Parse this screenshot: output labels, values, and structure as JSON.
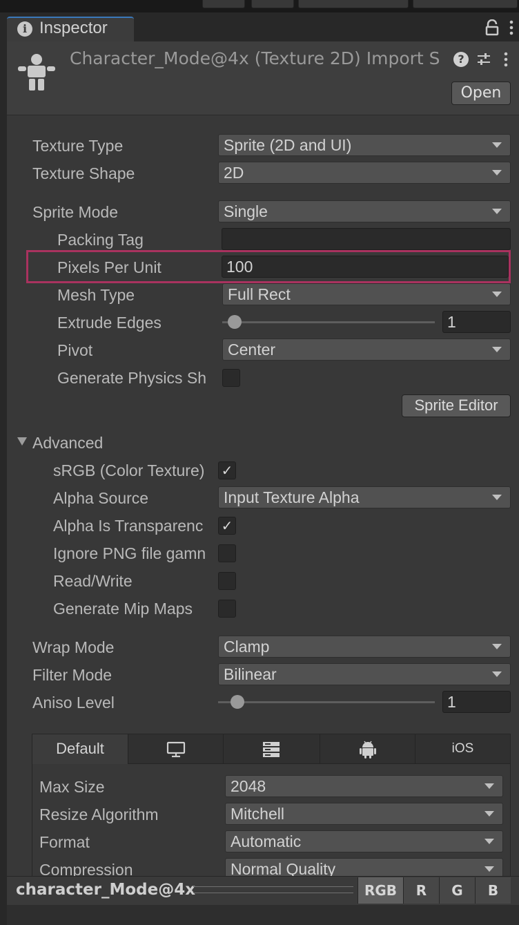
{
  "tab": {
    "title": "Inspector",
    "icon": "info-icon"
  },
  "header": {
    "title": "Character_Mode@4x (Texture 2D) Import S",
    "open_label": "Open",
    "icon": "character-icon"
  },
  "fields": {
    "texture_type": {
      "label": "Texture Type",
      "value": "Sprite (2D and UI)"
    },
    "texture_shape": {
      "label": "Texture Shape",
      "value": "2D"
    },
    "sprite_mode": {
      "label": "Sprite Mode",
      "value": "Single"
    },
    "packing_tag": {
      "label": "Packing Tag",
      "value": ""
    },
    "pixels_per_unit": {
      "label": "Pixels Per Unit",
      "value": "100"
    },
    "mesh_type": {
      "label": "Mesh Type",
      "value": "Full Rect"
    },
    "extrude_edges": {
      "label": "Extrude Edges",
      "value": "1",
      "slider_fraction": 0.06
    },
    "pivot": {
      "label": "Pivot",
      "value": "Center"
    },
    "generate_physics": {
      "label": "Generate Physics Sh",
      "checked": false
    },
    "sprite_editor_label": "Sprite Editor"
  },
  "advanced": {
    "label": "Advanced",
    "srgb": {
      "label": "sRGB (Color Texture)",
      "checked": true
    },
    "alpha_source": {
      "label": "Alpha Source",
      "value": "Input Texture Alpha"
    },
    "alpha_is_transparency": {
      "label": "Alpha Is Transparenc",
      "checked": true
    },
    "ignore_png_gamma": {
      "label": "Ignore PNG file gamn",
      "checked": false
    },
    "read_write": {
      "label": "Read/Write",
      "checked": false
    },
    "generate_mip_maps": {
      "label": "Generate Mip Maps",
      "checked": false
    }
  },
  "wrap": {
    "wrap_mode": {
      "label": "Wrap Mode",
      "value": "Clamp"
    },
    "filter_mode": {
      "label": "Filter Mode",
      "value": "Bilinear"
    },
    "aniso_level": {
      "label": "Aniso Level",
      "value": "1",
      "slider_fraction": 0.09
    }
  },
  "platform": {
    "tabs": [
      "Default",
      "monitor-icon",
      "server-icon",
      "android-icon",
      "iOS"
    ],
    "max_size": {
      "label": "Max Size",
      "value": "2048"
    },
    "resize_algorithm": {
      "label": "Resize Algorithm",
      "value": "Mitchell"
    },
    "format": {
      "label": "Format",
      "value": "Automatic"
    },
    "compression": {
      "label": "Compression",
      "value": "Normal Quality"
    }
  },
  "preview": {
    "name": "character_Mode@4x",
    "channels": [
      "RGB",
      "R",
      "G",
      "B"
    ]
  },
  "colors": {
    "highlight": "#a9325f",
    "active_tab": "#3a79bb"
  }
}
